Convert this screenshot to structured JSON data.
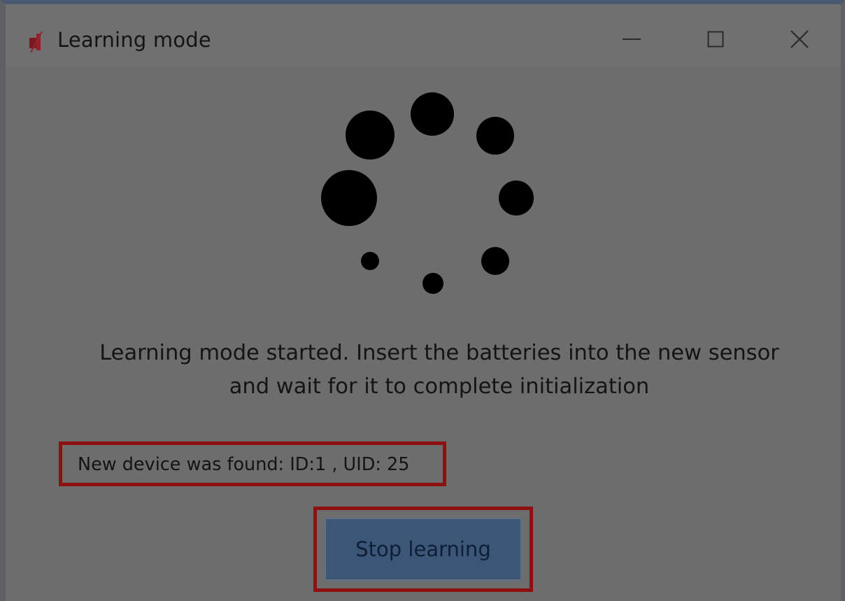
{
  "window": {
    "title": "Learning mode",
    "controls": {
      "minimize": "minimize-icon",
      "maximize": "maximize-icon",
      "close": "close-icon"
    }
  },
  "spinner": {
    "dot_count": 8
  },
  "message": {
    "line1": "Learning mode started. Insert the batteries into the new sensor",
    "line2": "and wait for it to complete initialization"
  },
  "status": {
    "text": "New device was found: ID:1 , UID: 25"
  },
  "actions": {
    "stop_label": "Stop learning"
  },
  "colors": {
    "background": "#6d6d6d",
    "highlight_border": "#8f1010",
    "button_fill": "#3b5677",
    "button_text": "#0d1e36",
    "dots": "#000000"
  }
}
